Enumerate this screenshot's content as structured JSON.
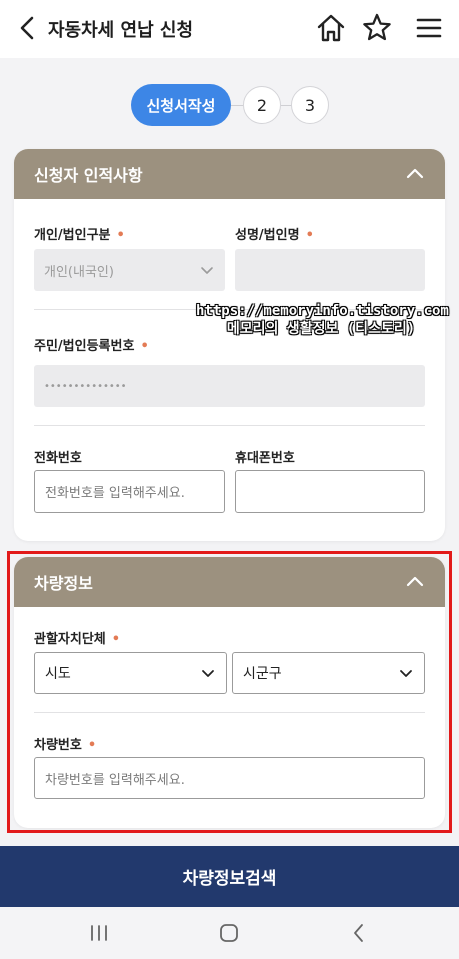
{
  "header": {
    "title": "자동차세 연납 신청",
    "back_icon": "chevron-left-icon",
    "home_icon": "home-icon",
    "star_icon": "star-icon",
    "menu_icon": "hamburger-menu-icon"
  },
  "steps": {
    "active_label": "신청서작성",
    "step2": "2",
    "step3": "3",
    "accent_color": "#3d86e6"
  },
  "applicant": {
    "section_title": "신청자 인적사항",
    "type_label": "개인/법인구분",
    "type_value": "개인(내국인)",
    "name_label": "성명/법인명",
    "name_value": "",
    "regno_label": "주민/법인등록번호",
    "regno_value": "••••••••••••••",
    "phone_label": "전화번호",
    "phone_placeholder": "전화번호를 입력해주세요.",
    "mobile_label": "휴대폰번호",
    "mobile_placeholder": ""
  },
  "vehicle": {
    "section_title": "차량정보",
    "jurisdiction_label": "관할자치단체",
    "sido_value": "시도",
    "sigungu_value": "시군구",
    "carno_label": "차량번호",
    "carno_placeholder": "차량번호를 입력해주세요."
  },
  "required_mark": "•",
  "watermark": {
    "line1": "https://memoryinfo.tistory.com",
    "line2": "메모리의 생활정보 (티스토리)"
  },
  "search_button": "차량정보검색",
  "colors": {
    "section_header": "#9c917f",
    "search_button": "#22396d",
    "highlight": "#e21a1a",
    "required": "#e37b55"
  }
}
